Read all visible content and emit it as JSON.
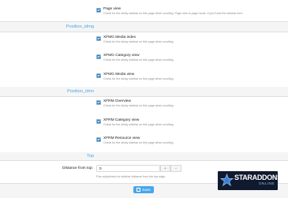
{
  "sections": [
    {
      "title": "Position_idmg",
      "options": [
        {
          "label": "XFMG Media index",
          "hint": "Check for the sticky sidebar on this page when scrolling."
        },
        {
          "label": "XFMG Category view",
          "hint": "Check for the sticky sidebar on this page when scrolling."
        },
        {
          "label": "XFMG Media view",
          "hint": "Check for the sticky sidebar on this page when scrolling."
        }
      ]
    },
    {
      "title": "Position_idrm",
      "options": [
        {
          "label": "XFRM Overview",
          "hint": "Check for the sticky sidebar on this page when scrolling."
        },
        {
          "label": "XFRM Category view",
          "hint": "Check for the sticky sidebar on this page when scrolling."
        },
        {
          "label": "XFRM Resource view",
          "hint": "Check for the sticky sidebar on this page when scrolling."
        }
      ]
    },
    {
      "title": "Top",
      "options": []
    }
  ],
  "page_view": {
    "label": "Page view",
    "hint": "Check for the sticky sidebar on this page when scrolling. Page view is page mode, if you'll add the sidebar here."
  },
  "distance": {
    "label": "Distance from top:",
    "value": "0",
    "hint": "Fine adjustment for sidebar distance from the top edge.",
    "plus": "+",
    "minus": "−"
  },
  "save": {
    "label": "Save"
  },
  "logo": {
    "line1": "STARADDONS",
    "line2": "ONLINE"
  },
  "colors": {
    "accent": "#47a7eb",
    "checkbox": "#2577b1",
    "band": "#f5f5f5"
  }
}
